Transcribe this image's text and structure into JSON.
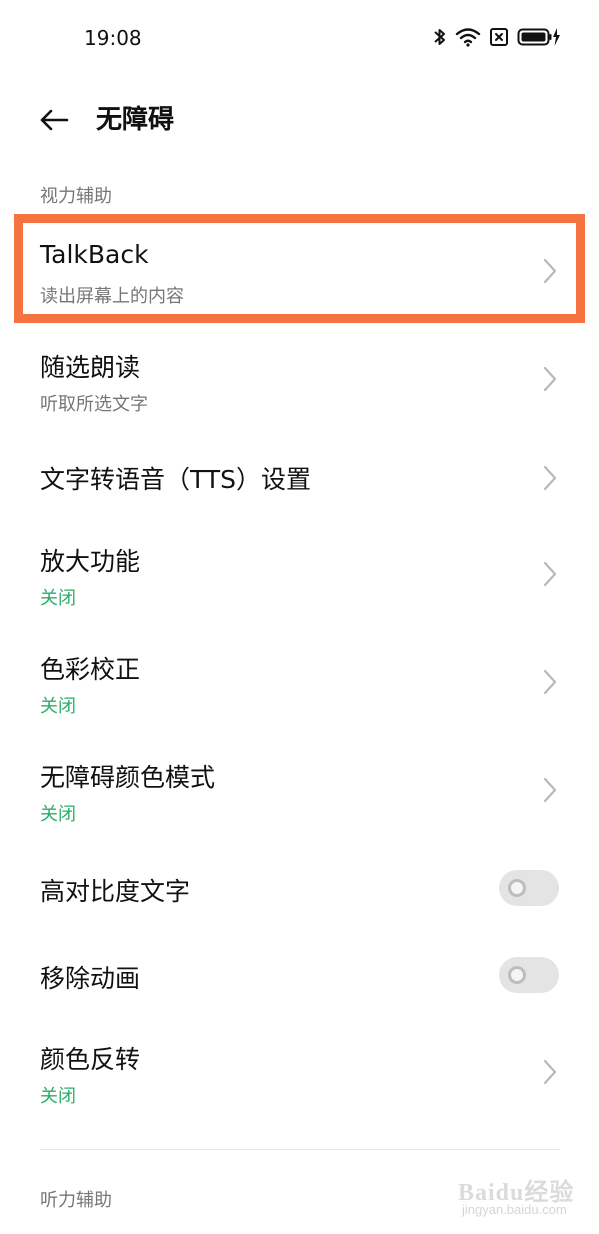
{
  "status_bar": {
    "time": "19:08"
  },
  "header": {
    "title": "无障碍"
  },
  "sections": {
    "vision": "视力辅助",
    "hearing": "听力辅助"
  },
  "items": [
    {
      "title": "TalkBack",
      "subtitle": "读出屏幕上的内容"
    },
    {
      "title": "随选朗读",
      "subtitle": "听取所选文字"
    },
    {
      "title": "文字转语音（TTS）设置"
    },
    {
      "title": "放大功能",
      "subtitle": "关闭"
    },
    {
      "title": "色彩校正",
      "subtitle": "关闭"
    },
    {
      "title": "无障碍颜色模式",
      "subtitle": "关闭"
    },
    {
      "title": "高对比度文字",
      "toggle_on": false
    },
    {
      "title": "移除动画",
      "toggle_on": false
    },
    {
      "title": "颜色反转",
      "subtitle": "关闭"
    }
  ],
  "colors": {
    "highlight": "#f4733f",
    "status_off_text": "#2aae67"
  },
  "watermark": {
    "brand": "Baidu经验",
    "site": "jingyan.baidu.com"
  }
}
